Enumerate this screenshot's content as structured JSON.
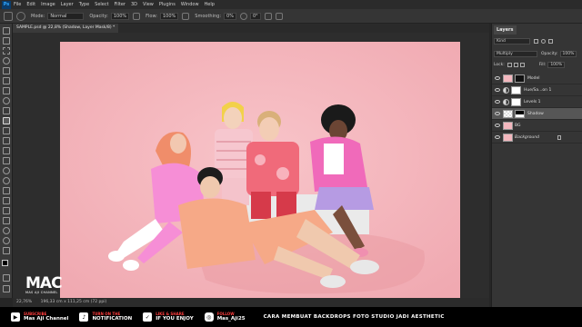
{
  "menubar": {
    "logo": "Ps",
    "items": [
      "File",
      "Edit",
      "Image",
      "Layer",
      "Type",
      "Select",
      "Filter",
      "3D",
      "View",
      "Plugins",
      "Window",
      "Help"
    ]
  },
  "options": {
    "mode_label": "Mode:",
    "mode_value": "Normal",
    "opacity_label": "Opacity:",
    "opacity_value": "100%",
    "flow_label": "Flow:",
    "flow_value": "100%",
    "smoothing_label": "Smoothing:",
    "smoothing_value": "0%",
    "angle_value": "0°"
  },
  "document": {
    "tab_title": "SAMPLE.psd @ 22,8% (Shadow, Layer Mask/8) *"
  },
  "status": {
    "zoom": "22,76%",
    "doc_info": "196,33 cm x 111,25 cm (72 ppi)"
  },
  "layers_panel": {
    "tab_label": "Layers",
    "filter_value": "Kind",
    "blend_mode": "Multiply",
    "opacity_label": "Opacity:",
    "opacity_value": "100%",
    "lock_label": "Lock:",
    "fill_label": "Fill:",
    "fill_value": "100%",
    "layers": [
      {
        "name": "Model",
        "selected": false,
        "type": "image"
      },
      {
        "name": "Hue/Sa...on 1",
        "selected": false,
        "type": "adjustment"
      },
      {
        "name": "Levels 1",
        "selected": false,
        "type": "adjustment"
      },
      {
        "name": "Shadow",
        "selected": true,
        "type": "mask"
      },
      {
        "name": "BG",
        "selected": false,
        "type": "color"
      },
      {
        "name": "Background",
        "selected": false,
        "type": "color"
      }
    ]
  },
  "banner": {
    "subscribe_small": "SUBSCRIBE",
    "subscribe_big": "Mas Aji Channel",
    "notify_small": "TURN ON THE",
    "notify_big": "NOTIFICATION",
    "share_small": "LIKE & SHARE",
    "share_big": "IF YOU ENJOY",
    "follow_small": "FOLLOW",
    "follow_big": "Mas_Aji25",
    "title": "CARA MEMBUAT BACKDROPS FOTO STUDIO JADI AESTHETIC"
  },
  "watermark": {
    "logo": "MAC",
    "tagline": "MAS AJI CHANNEL"
  },
  "colors": {
    "backdrop": "#f4b6bd",
    "panel": "#353535",
    "accent_red": "#ff3d3d"
  }
}
